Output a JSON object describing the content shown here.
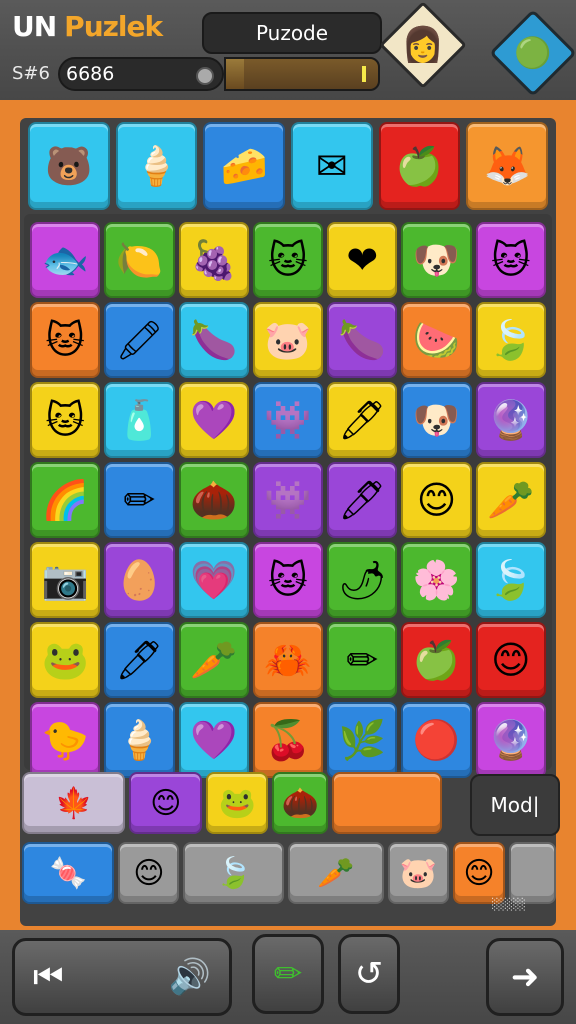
{
  "header": {
    "brand_part1": "UN",
    "brand_part2": "Puzlek",
    "title_label": "Puzode",
    "score_label": "S#6",
    "score_value": "6686",
    "meter_fill": 0.12,
    "avatar_icon": "girl-portrait-icon",
    "gem_icon": "green-blob-gem-icon"
  },
  "colors": {
    "board_bg": "#e8842f",
    "panel_bg": "#424242",
    "bar_bg": "#4e4e4e"
  },
  "top_row": [
    {
      "bg": "#33c6ee",
      "glyph": "🐻",
      "icon": "orange-bear-icon"
    },
    {
      "bg": "#33c6ee",
      "glyph": "🍦",
      "icon": "ice-cream-icon"
    },
    {
      "bg": "#2e87e0",
      "glyph": "🧀",
      "icon": "yellow-sponge-icon"
    },
    {
      "bg": "#33c6ee",
      "glyph": "✉",
      "icon": "envelope-icon"
    },
    {
      "bg": "#e4231f",
      "glyph": "🍏",
      "icon": "green-drop-icon"
    },
    {
      "bg": "#f5962f",
      "glyph": "🦊",
      "icon": "fox-face-icon"
    }
  ],
  "grid": [
    {
      "bg": "#c846e0",
      "glyph": "🐟",
      "icon": "blue-fish-icon"
    },
    {
      "bg": "#4cb82e",
      "glyph": "🍋",
      "icon": "yellow-lemon-icon"
    },
    {
      "bg": "#f4d21a",
      "glyph": "🍇",
      "icon": "purple-plum-icon"
    },
    {
      "bg": "#4cb82e",
      "glyph": "🐱",
      "icon": "yellow-cat-icon"
    },
    {
      "bg": "#f4d21a",
      "glyph": "❤",
      "icon": "red-heart-icon"
    },
    {
      "bg": "#4cb82e",
      "glyph": "🐶",
      "icon": "brown-dog-icon"
    },
    {
      "bg": "#c846e0",
      "glyph": "🐱",
      "icon": "purple-cat-icon"
    },
    {
      "bg": "#f5822a",
      "glyph": "🐱",
      "icon": "orange-cat-icon"
    },
    {
      "bg": "#2e87e0",
      "glyph": "🖍",
      "icon": "green-crayon-icon"
    },
    {
      "bg": "#33c6ee",
      "glyph": "🍆",
      "icon": "purple-oval-icon"
    },
    {
      "bg": "#f4d21a",
      "glyph": "🐷",
      "icon": "pink-pig-icon"
    },
    {
      "bg": "#9a46d8",
      "glyph": "🍆",
      "icon": "purple-egg-icon"
    },
    {
      "bg": "#f5822a",
      "glyph": "🍉",
      "icon": "melon-ball-icon"
    },
    {
      "bg": "#f4d21a",
      "glyph": "🍃",
      "icon": "green-leaf-icon"
    },
    {
      "bg": "#f4d21a",
      "glyph": "🐱",
      "icon": "orange-cat-icon"
    },
    {
      "bg": "#33c6ee",
      "glyph": "🧴",
      "icon": "orange-bottle-icon"
    },
    {
      "bg": "#f4d21a",
      "glyph": "💜",
      "icon": "purple-heart-icon"
    },
    {
      "bg": "#2e87e0",
      "glyph": "👾",
      "icon": "purple-monster-icon"
    },
    {
      "bg": "#f4d21a",
      "glyph": "🖊",
      "icon": "blue-pen-icon"
    },
    {
      "bg": "#2e87e0",
      "glyph": "🐶",
      "icon": "brown-dog-icon"
    },
    {
      "bg": "#9a46d8",
      "glyph": "🔮",
      "icon": "purple-orb-icon"
    },
    {
      "bg": "#4cb82e",
      "glyph": "🌈",
      "icon": "rainbow-icon"
    },
    {
      "bg": "#2e87e0",
      "glyph": "✏",
      "icon": "yellow-pencil-icon"
    },
    {
      "bg": "#4cb82e",
      "glyph": "🌰",
      "icon": "brown-seed-icon"
    },
    {
      "bg": "#9a46d8",
      "glyph": "👾",
      "icon": "purple-blob-icon"
    },
    {
      "bg": "#9a46d8",
      "glyph": "🖊",
      "icon": "blue-marker-icon"
    },
    {
      "bg": "#f4d21a",
      "glyph": "😊",
      "icon": "green-face-icon"
    },
    {
      "bg": "#f4d21a",
      "glyph": "🥕",
      "icon": "orange-carrot-icon"
    },
    {
      "bg": "#f4d21a",
      "glyph": "📷",
      "icon": "orange-camera-icon"
    },
    {
      "bg": "#9a46d8",
      "glyph": "🥚",
      "icon": "orange-egg-icon"
    },
    {
      "bg": "#33c6ee",
      "glyph": "💗",
      "icon": "pink-heart-icon"
    },
    {
      "bg": "#c846e0",
      "glyph": "🐱",
      "icon": "purple-cat-icon"
    },
    {
      "bg": "#4cb82e",
      "glyph": "🌶",
      "icon": "red-chili-icon"
    },
    {
      "bg": "#4cb82e",
      "glyph": "🌸",
      "icon": "orange-flower-icon"
    },
    {
      "bg": "#33c6ee",
      "glyph": "🍃",
      "icon": "green-leaf-icon"
    },
    {
      "bg": "#f4d21a",
      "glyph": "🐸",
      "icon": "green-frog-icon"
    },
    {
      "bg": "#2e87e0",
      "glyph": "🖊",
      "icon": "purple-pen-icon"
    },
    {
      "bg": "#4cb82e",
      "glyph": "🥕",
      "icon": "orange-carrot-icon"
    },
    {
      "bg": "#f5822a",
      "glyph": "🦀",
      "icon": "orange-crab-icon"
    },
    {
      "bg": "#4cb82e",
      "glyph": "✏",
      "icon": "yellow-pencil-icon"
    },
    {
      "bg": "#e4231f",
      "glyph": "🍏",
      "icon": "green-apple-icon"
    },
    {
      "bg": "#e4231f",
      "glyph": "😊",
      "icon": "orange-smiley-icon"
    },
    {
      "bg": "#c846e0",
      "glyph": "🐤",
      "icon": "yellow-chick-icon"
    },
    {
      "bg": "#2e87e0",
      "glyph": "🍦",
      "icon": "ice-cream-icon"
    },
    {
      "bg": "#33c6ee",
      "glyph": "💜",
      "icon": "purple-heart-icon"
    },
    {
      "bg": "#f5822a",
      "glyph": "🍒",
      "icon": "cherry-leaf-icon"
    },
    {
      "bg": "#2e87e0",
      "glyph": "🌿",
      "icon": "blue-fern-icon"
    },
    {
      "bg": "#2e87e0",
      "glyph": "🔴",
      "icon": "red-ball-icon"
    },
    {
      "bg": "#c846e0",
      "glyph": "🔮",
      "icon": "purple-gem-icon"
    }
  ],
  "tray_row1": [
    {
      "bg": "#c9bfd6",
      "glyph": "🍁",
      "icon": "red-leaf-icon",
      "flex": 1.45
    },
    {
      "bg": "#9a46d8",
      "glyph": "😊",
      "icon": "orange-smiley-icon",
      "flex": 1
    },
    {
      "bg": "#f4d21a",
      "glyph": "🐸",
      "icon": "green-face-icon",
      "flex": 0.85
    },
    {
      "bg": "#4cb82e",
      "glyph": "🌰",
      "icon": "brown-nut-icon",
      "flex": 0.75
    },
    {
      "bg": "#f5822a",
      "glyph": "",
      "icon": "empty-slot-icon",
      "flex": 1.55
    }
  ],
  "mode_label": "Mod|",
  "tray_row2": [
    {
      "bg": "#2e87e0",
      "glyph": "🍬",
      "icon": "blue-candy-icon",
      "flex": 1.55
    },
    {
      "bg": "#9a9a9a",
      "glyph": "😊",
      "icon": "orange-smiley-icon",
      "flex": 1
    },
    {
      "bg": "#9a9a9a",
      "glyph": "🍃",
      "icon": "green-drop-icon",
      "flex": 1.7
    },
    {
      "bg": "#9a9a9a",
      "glyph": "🥕",
      "icon": "orange-carrot-icon",
      "flex": 1.6
    },
    {
      "bg": "#9a9a9a",
      "glyph": "🐷",
      "icon": "pink-pig-icon",
      "flex": 1
    },
    {
      "bg": "#f5822a",
      "glyph": "😊",
      "icon": "orange-smiley-icon",
      "flex": 0.85
    },
    {
      "bg": "#9a9a9a",
      "glyph": "",
      "icon": "empty-slot-icon",
      "flex": 0.75
    }
  ],
  "watermark": "░░░░",
  "bottom": {
    "rewind_icon": "rewind-icon",
    "sound_icon": "speaker-icon",
    "pencil_icon": "pencil-icon",
    "hint_icon": "hook-icon",
    "next_icon": "arrow-right-icon"
  }
}
